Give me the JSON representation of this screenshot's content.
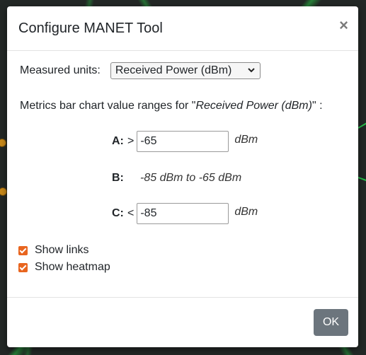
{
  "dialog": {
    "title": "Configure MANET Tool",
    "close_glyph": "×"
  },
  "units": {
    "label": "Measured units:",
    "selected": "Received Power (dBm)"
  },
  "ranges": {
    "desc_prefix": "Metrics bar chart value ranges for \"",
    "desc_units": "Received Power (dBm)",
    "desc_suffix": "\" :",
    "a": {
      "label": "A:",
      "op": ">",
      "value": "-65",
      "unit": "dBm"
    },
    "b": {
      "label": "B:",
      "text": "-85 dBm to -65 dBm"
    },
    "c": {
      "label": "C:",
      "op": "<",
      "value": "-85",
      "unit": "dBm"
    }
  },
  "options": {
    "show_links": {
      "label": "Show links",
      "checked": true
    },
    "show_heatmap": {
      "label": "Show heatmap",
      "checked": true
    }
  },
  "footer": {
    "ok_label": "OK"
  },
  "colors": {
    "checkbox": "#e8651f",
    "ok_button": "#6c757d",
    "map_link": "#29c04b"
  }
}
